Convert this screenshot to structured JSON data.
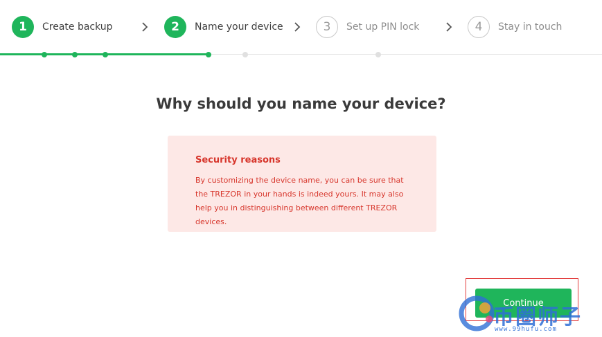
{
  "steps": [
    {
      "number": "1",
      "label": "Create backup",
      "state": "done"
    },
    {
      "number": "2",
      "label": "Name your device",
      "state": "done"
    },
    {
      "number": "3",
      "label": "Set up PIN lock",
      "state": "todo"
    },
    {
      "number": "4",
      "label": "Stay in touch",
      "state": "todo"
    }
  ],
  "heading": "Why should you name your device?",
  "notice": {
    "title": "Security reasons",
    "body": "By customizing the device name, you can be sure that the TREZOR in your hands is indeed yours. It may also help you in distinguishing between different TREZOR devices."
  },
  "actions": {
    "continue_label": "Continue"
  },
  "watermark": {
    "text": "币圈师子",
    "url": "www.99hufu.com"
  },
  "colors": {
    "accent": "#1fb55b",
    "notice_bg": "#fde8e6",
    "notice_text": "#d7362c",
    "highlight": "#e23b3b"
  },
  "icons": {
    "step_separator": "chevron-right-icon"
  }
}
